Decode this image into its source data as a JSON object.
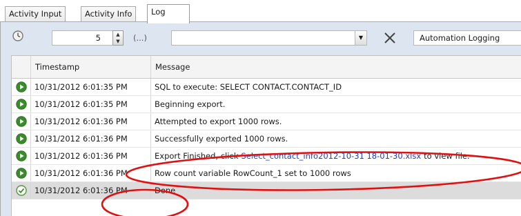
{
  "tabs": [
    {
      "label": "Activity Input",
      "active": false
    },
    {
      "label": "Activity Info",
      "active": false
    },
    {
      "label": "Log",
      "active": true
    }
  ],
  "toolbar": {
    "count_value": "5",
    "ellipsis_label": "(...)",
    "filter_value": "",
    "logging_value": "Automation Logging"
  },
  "grid": {
    "columns": [
      "Timestamp",
      "Message"
    ],
    "rows": [
      {
        "icon": "play-circle-icon",
        "timestamp": "10/31/2012 6:01:35 PM",
        "message": "SQL to execute: SELECT  CONTACT.CONTACT_ID"
      },
      {
        "icon": "play-circle-icon",
        "timestamp": "10/31/2012 6:01:35 PM",
        "message": "Beginning export."
      },
      {
        "icon": "play-circle-icon",
        "timestamp": "10/31/2012 6:01:36 PM",
        "message": "Attempted to export 1000 rows."
      },
      {
        "icon": "play-circle-icon",
        "timestamp": "10/31/2012 6:01:36 PM",
        "message": "Successfully exported 1000 rows."
      },
      {
        "icon": "play-circle-icon",
        "timestamp": "10/31/2012 6:01:36 PM",
        "message_prefix": "Export Finished, click",
        "link": "Select_contact_info2012-10-31 18-01-30.xlsx",
        "message_suffix": "to view file."
      },
      {
        "icon": "play-circle-icon",
        "timestamp": "10/31/2012 6:01:36 PM",
        "message": "Row count variable RowCount_1 set to 1000 rows"
      },
      {
        "icon": "check-circle-icon",
        "timestamp": "10/31/2012 6:01:36 PM",
        "message": "Done",
        "selected": true
      }
    ]
  },
  "colors": {
    "panel_bg": "#dde6f0",
    "play_icon": "#3d8a2e",
    "annotation": "#e01010",
    "link": "#1f3fbf"
  }
}
